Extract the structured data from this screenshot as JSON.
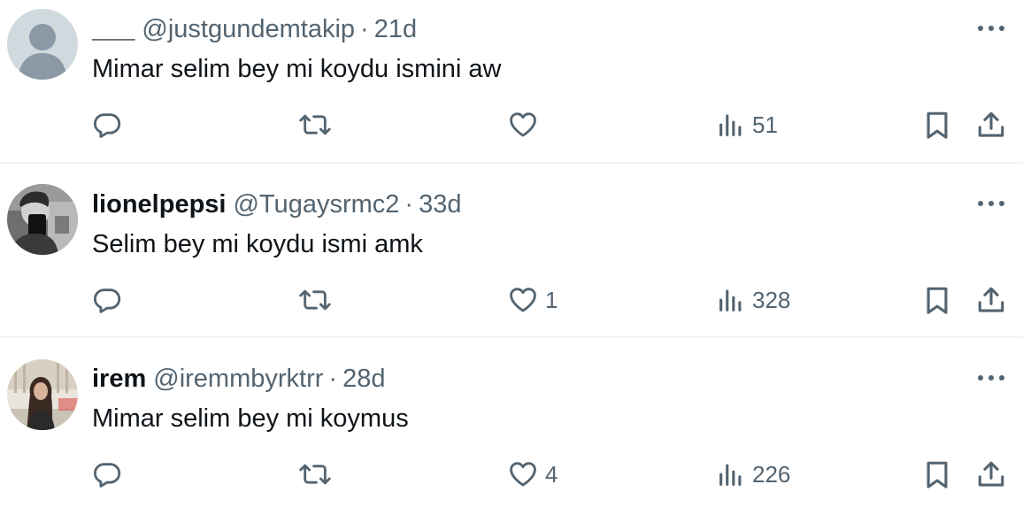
{
  "tweets": [
    {
      "name": "___",
      "handle": "@justgundemtakip",
      "separator": "·",
      "time": "21d",
      "text": "Mimar selim bey mi koydu ismini aw",
      "replies": "",
      "retweets": "",
      "likes": "",
      "views": "51",
      "avatar": "default-avatar"
    },
    {
      "name": "lionelpepsi",
      "handle": "@Tugaysrmc2",
      "separator": "·",
      "time": "33d",
      "text": "Selim bey mi koydu ismi amk",
      "replies": "",
      "retweets": "",
      "likes": "1",
      "views": "328",
      "avatar": "photo-grayscale-person"
    },
    {
      "name": "irem",
      "handle": "@iremmbyrktrr",
      "separator": "·",
      "time": "28d",
      "text": "Mimar selim bey mi koymus",
      "replies": "",
      "retweets": "",
      "likes": "4",
      "views": "226",
      "avatar": "photo-person-indoor"
    }
  ],
  "colors": {
    "text": "#0f1419",
    "secondary": "#536471",
    "divider": "#eff3f4",
    "default_avatar_bg": "#cfd9de",
    "default_avatar_fg": "#8b98a5"
  }
}
